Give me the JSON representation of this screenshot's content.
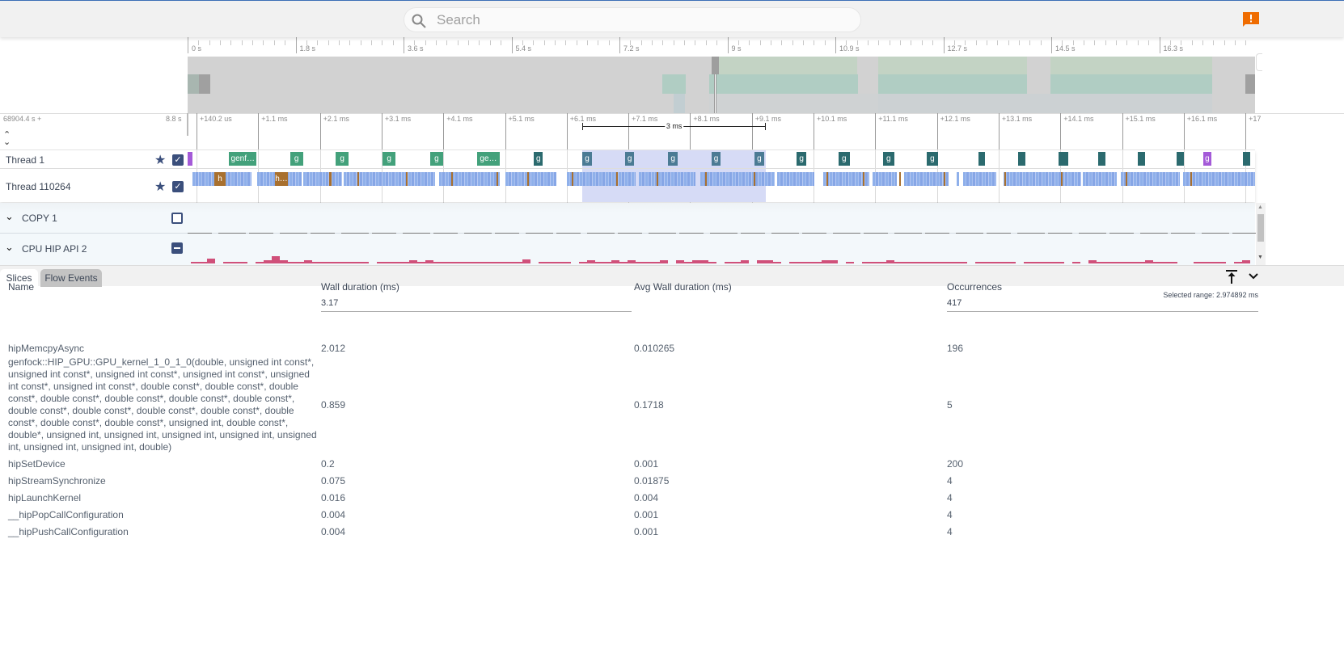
{
  "search": {
    "placeholder": "Search"
  },
  "alert_icon": "alert-speech-bubble-icon",
  "overview": {
    "ticks": [
      "0 s",
      "1.8 s",
      "3.6 s",
      "5.4 s",
      "7.2 s",
      "9 s",
      "10.9 s",
      "12.7 s",
      "14.5 s",
      "16.3 s"
    ]
  },
  "timeline": {
    "origin": "68904.4 s +",
    "span": "8.8 s",
    "ticks": [
      "+140.2 us",
      "+1.1 ms",
      "+2.1 ms",
      "+3.1 ms",
      "+4.1 ms",
      "+5.1 ms",
      "+6.1 ms",
      "+7.1 ms",
      "+8.1 ms",
      "+9.1 ms",
      "+10.1 ms",
      "+11.1 ms",
      "+12.1 ms",
      "+13.1 ms",
      "+14.1 ms",
      "+15.1 ms",
      "+16.1 ms",
      "+17"
    ],
    "measure_label": "3 ms",
    "selection_ms": [
      6.4,
      9.37
    ]
  },
  "tracks": [
    {
      "name": "Thread 1",
      "pinned": true,
      "checked": "checked",
      "slices": [
        {
          "label": "",
          "start": 0,
          "dur": 0.08,
          "color": "#a45ad8"
        },
        {
          "label": "genf…",
          "start": 0.67,
          "dur": 0.45,
          "color": "#43a17b"
        },
        {
          "label": "g",
          "start": 1.66,
          "dur": 0.21,
          "color": "#43a17b"
        },
        {
          "label": "g",
          "start": 2.4,
          "dur": 0.21,
          "color": "#43a17b"
        },
        {
          "label": "g",
          "start": 3.16,
          "dur": 0.21,
          "color": "#43a17b"
        },
        {
          "label": "g",
          "start": 3.93,
          "dur": 0.21,
          "color": "#43a17b"
        },
        {
          "label": "ge…",
          "start": 4.69,
          "dur": 0.37,
          "color": "#43a17b"
        },
        {
          "label": "g",
          "start": 5.61,
          "dur": 0.15,
          "color": "#2b6a6e"
        },
        {
          "label": "g",
          "start": 6.4,
          "dur": 0.15,
          "color": "#4b7b94"
        },
        {
          "label": "g",
          "start": 7.09,
          "dur": 0.15,
          "color": "#4b7b94"
        },
        {
          "label": "g",
          "start": 7.79,
          "dur": 0.15,
          "color": "#4b7b94"
        },
        {
          "label": "g",
          "start": 8.49,
          "dur": 0.15,
          "color": "#4b7b94"
        },
        {
          "label": "g",
          "start": 9.19,
          "dur": 0.15,
          "color": "#4b7b94"
        },
        {
          "label": "g",
          "start": 9.87,
          "dur": 0.16,
          "color": "#2b6a6e"
        },
        {
          "label": "g",
          "start": 10.55,
          "dur": 0.18,
          "color": "#2b6a6e"
        },
        {
          "label": "g",
          "start": 11.27,
          "dur": 0.18,
          "color": "#2b6a6e"
        },
        {
          "label": "g",
          "start": 11.98,
          "dur": 0.18,
          "color": "#2b6a6e"
        },
        {
          "label": "",
          "start": 12.82,
          "dur": 0.1,
          "color": "#2b6a6e"
        },
        {
          "label": "",
          "start": 13.46,
          "dur": 0.12,
          "color": "#2b6a6e"
        },
        {
          "label": "",
          "start": 14.12,
          "dur": 0.15,
          "color": "#2b6a6e"
        },
        {
          "label": "",
          "start": 14.76,
          "dur": 0.12,
          "color": "#2b6a6e"
        },
        {
          "label": "",
          "start": 15.4,
          "dur": 0.12,
          "color": "#2b6a6e"
        },
        {
          "label": "",
          "start": 16.03,
          "dur": 0.12,
          "color": "#2b6a6e"
        },
        {
          "label": "g",
          "start": 16.46,
          "dur": 0.13,
          "color": "#a45ad8"
        },
        {
          "label": "",
          "start": 17.1,
          "dur": 0.12,
          "color": "#2b6a6e"
        }
      ]
    },
    {
      "name": "Thread 110264",
      "pinned": true,
      "checked": "checked",
      "slices": [
        {
          "label": "h",
          "start": 0.43,
          "dur": 0.19,
          "color": "#a8702f"
        },
        {
          "label": "h…",
          "start": 1.41,
          "dur": 0.22,
          "color": "#a8702f"
        }
      ]
    },
    {
      "name": "COPY 1",
      "checked": "unchecked"
    },
    {
      "name": "CPU HIP API 2",
      "checked": "partial"
    }
  ],
  "colors": {
    "slice_bg": "#8fb0ea",
    "selection": "#d6dbf6",
    "counter": "#d0507a",
    "accent": "#3b4f7c",
    "alert": "#ef6c00"
  },
  "details": {
    "tabs": [
      {
        "label": "Slices",
        "active": true
      },
      {
        "label": "Flow Events",
        "active": false
      }
    ],
    "selected_range": "Selected range: 2.974892 ms",
    "columns": [
      "Name",
      "Wall duration (ms)",
      "Avg Wall duration (ms)",
      "Occurrences"
    ],
    "totals": {
      "wall": "3.17",
      "occurrences": "417"
    },
    "rows": [
      {
        "name": "hipMemcpyAsync",
        "wall": "2.012",
        "avg": "0.010265",
        "occ": "196"
      },
      {
        "name": "genfock::HIP_GPU::GPU_kernel_1_0_1_0(double, unsigned int const*, unsigned int const*, unsigned int const*, unsigned int const*, unsigned int const*, unsigned int const*, double const*, double const*, double const*, double const*, double const*, double const*, double const*, double const*, double const*, double const*, double const*, double const*, double const*, double const*, unsigned int, double const*, double*, unsigned int, unsigned int, unsigned int, unsigned int, unsigned int, unsigned int, unsigned int, double)",
        "wall": "0.859",
        "avg": "0.1718",
        "occ": "5"
      },
      {
        "name": "hipSetDevice",
        "wall": "0.2",
        "avg": "0.001",
        "occ": "200"
      },
      {
        "name": "hipStreamSynchronize",
        "wall": "0.075",
        "avg": "0.01875",
        "occ": "4"
      },
      {
        "name": "hipLaunchKernel",
        "wall": "0.016",
        "avg": "0.004",
        "occ": "4"
      },
      {
        "name": "__hipPopCallConfiguration",
        "wall": "0.004",
        "avg": "0.001",
        "occ": "4"
      },
      {
        "name": "__hipPushCallConfiguration",
        "wall": "0.004",
        "avg": "0.001",
        "occ": "4"
      }
    ]
  }
}
